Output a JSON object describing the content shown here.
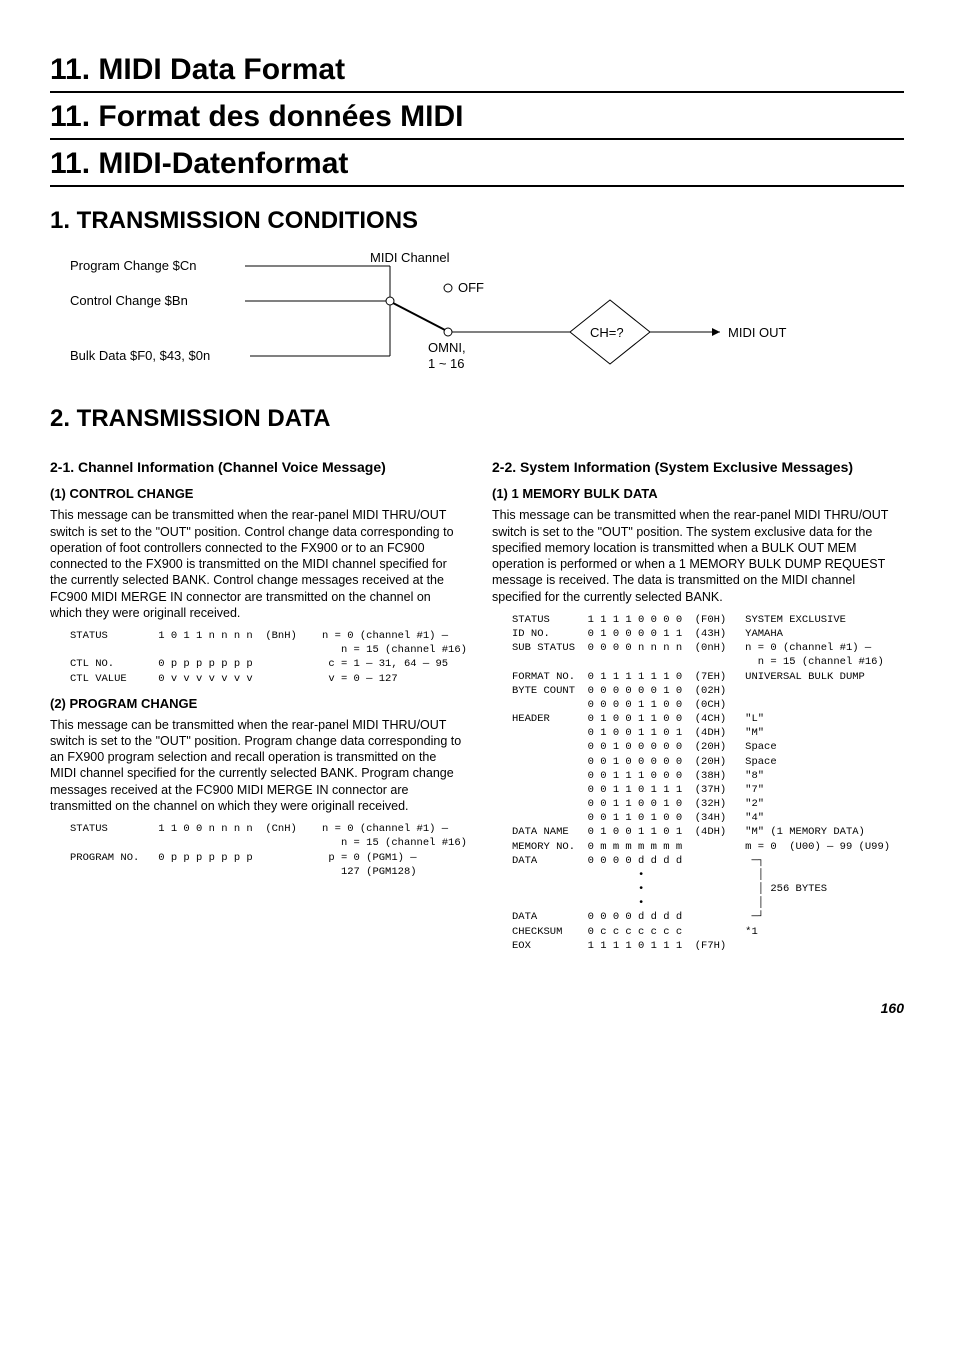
{
  "titles": {
    "en": "11. MIDI Data Format",
    "fr": "11. Format des données MIDI",
    "de": "11. MIDI-Datenformat"
  },
  "section1": {
    "heading": "1. TRANSMISSION CONDITIONS",
    "diagram": {
      "program_change": "Program Change  $Cn",
      "control_change": "Control Change  $Bn",
      "bulk_data": "Bulk Data  $F0, $43, $0n",
      "midi_channel": "MIDI Channel",
      "off": "OFF",
      "omni": "OMNI,",
      "range": "1 ~ 16",
      "ch_q": "CH=?",
      "midi_out": "MIDI OUT"
    }
  },
  "section2": {
    "heading": "2. TRANSMISSION DATA",
    "s21": {
      "heading": "2-1. Channel Information (Channel Voice Message)",
      "cc": {
        "title": "(1) CONTROL CHANGE",
        "body": "This message can be transmitted when the rear-panel MIDI THRU/OUT switch is set to the \"OUT\" position. Control change data corresponding to operation of foot controllers connected to the FX900 or to an FC900 connected to the FX900 is transmitted on the MIDI channel specified for the currently selected BANK. Control change messages received at the FC900 MIDI MERGE IN connector are transmitted on the channel on which they were originall received.",
        "table": "STATUS        1 0 1 1 n n n n  (BnH)    n = 0 (channel #1) —\n                                           n = 15 (channel #16)\nCTL NO.       0 p p p p p p p            c = 1 — 31, 64 — 95\nCTL VALUE     0 v v v v v v v            v = 0 — 127"
      },
      "pc": {
        "title": "(2) PROGRAM CHANGE",
        "body": "This message can be transmitted when the rear-panel MIDI THRU/OUT switch is set to the \"OUT\" position. Program change data corresponding to an FX900 program selection and recall operation is transmitted on the MIDI channel specified for the currently selected BANK. Program change messages received at the FC900 MIDI MERGE IN connector are transmitted on the channel on which they were originall received.",
        "table": "STATUS        1 1 0 0 n n n n  (CnH)    n = 0 (channel #1) —\n                                           n = 15 (channel #16)\nPROGRAM NO.   0 p p p p p p p            p = 0 (PGM1) —\n                                           127 (PGM128)"
      }
    },
    "s22": {
      "heading": "2-2. System Information (System Exclusive Messages)",
      "bulk": {
        "title": "(1) 1 MEMORY BULK DATA",
        "body": "This message can be transmitted when the rear-panel MIDI THRU/OUT switch is set to the \"OUT\" position. The system exclusive data for the specified memory location is transmitted when a BULK OUT MEM operation is performed or when a 1 MEMORY BULK DUMP REQUEST message is received. The data is transmitted on the MIDI channel specified for the currently selected BANK.",
        "table": "STATUS      1 1 1 1 0 0 0 0  (F0H)   SYSTEM EXCLUSIVE\nID NO.      0 1 0 0 0 0 1 1  (43H)   YAMAHA\nSUB STATUS  0 0 0 0 n n n n  (0nH)   n = 0 (channel #1) —\n                                       n = 15 (channel #16)\nFORMAT NO.  0 1 1 1 1 1 1 0  (7EH)   UNIVERSAL BULK DUMP\nBYTE COUNT  0 0 0 0 0 0 1 0  (02H)\n            0 0 0 0 1 1 0 0  (0CH)\nHEADER      0 1 0 0 1 1 0 0  (4CH)   \"L\"\n            0 1 0 0 1 1 0 1  (4DH)   \"M\"\n            0 0 1 0 0 0 0 0  (20H)   Space\n            0 0 1 0 0 0 0 0  (20H)   Space\n            0 0 1 1 1 0 0 0  (38H)   \"8\"\n            0 0 1 1 0 1 1 1  (37H)   \"7\"\n            0 0 1 1 0 0 1 0  (32H)   \"2\"\n            0 0 1 1 0 1 0 0  (34H)   \"4\"\nDATA NAME   0 1 0 0 1 1 0 1  (4DH)   \"M\" (1 MEMORY DATA)\nMEMORY NO.  0 m m m m m m m          m = 0  (U00) — 99 (U99)\nDATA        0 0 0 0 d d d d           ─┐\n                    •                  │\n                    •                  │ 256 BYTES\n                    •                  │\nDATA        0 0 0 0 d d d d           ─┘\nCHECKSUM    0 c c c c c c c          *1\nEOX         1 1 1 1 0 1 1 1  (F7H)"
      }
    }
  },
  "page": "160"
}
